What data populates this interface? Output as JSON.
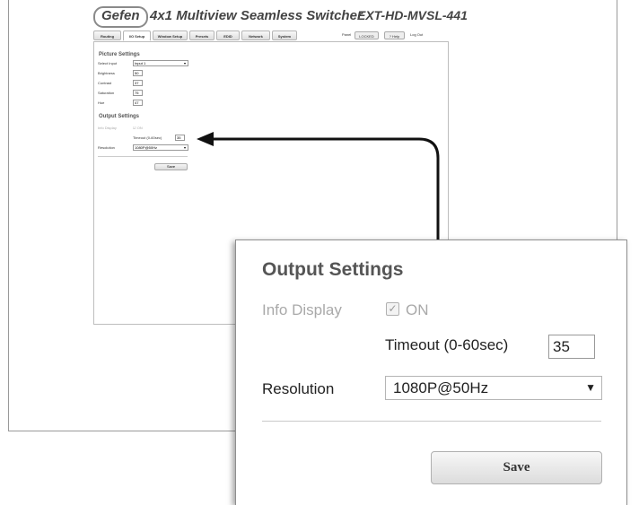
{
  "header": {
    "logo": "Gefen",
    "title": "4x1 Multiview Seamless Switcher",
    "model": "EXT-HD-MVSL-441"
  },
  "tabs": [
    {
      "label": "Routing"
    },
    {
      "label": "I/O Setup"
    },
    {
      "label": "Window Setup"
    },
    {
      "label": "Presets"
    },
    {
      "label": "EDID"
    },
    {
      "label": "Network"
    },
    {
      "label": "System"
    }
  ],
  "toolbar": {
    "panel_label": "Panel",
    "lock_label": "LOCKED",
    "help_label": "? Help",
    "logout_label": "Log Out"
  },
  "picture_settings": {
    "title": "Picture Settings",
    "select_input_label": "Select Input",
    "select_input_value": "Input 1",
    "brightness_label": "Brightness",
    "brightness_value": "50",
    "contrast_label": "Contrast",
    "contrast_value": "37",
    "saturation_label": "Saturation",
    "saturation_value": "75",
    "hue_label": "Hue",
    "hue_value": "47"
  },
  "output_settings": {
    "title": "Output Settings",
    "info_display_label": "Info Display",
    "info_display_checked": true,
    "on_label": "ON",
    "timeout_label": "Timeout (0-60sec)",
    "timeout_value": "35",
    "resolution_label": "Resolution",
    "resolution_value": "1080P@50Hz",
    "save_label": "Save"
  }
}
